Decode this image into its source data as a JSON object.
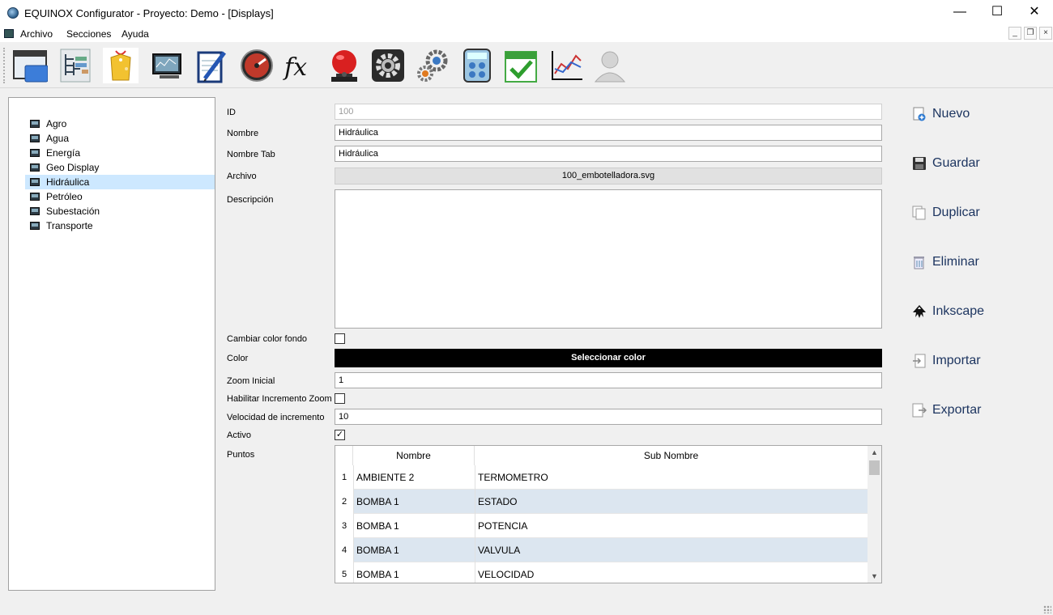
{
  "window": {
    "title": "EQUINOX Configurator - Proyecto: Demo - [Displays]"
  },
  "menu": {
    "items": [
      "Archivo",
      "Secciones",
      "Ayuda"
    ]
  },
  "toolbar": {
    "icons": [
      "window-icon",
      "tree-structure-icon",
      "tags-icon",
      "monitor-icon",
      "notepad-pen-icon",
      "gauge-icon",
      "function-fx-icon",
      "alarm-bell-icon",
      "gear-icon",
      "gears-icon",
      "calculator-icon",
      "calendar-check-icon",
      "line-chart-icon",
      "user-icon"
    ]
  },
  "tree": {
    "items": [
      {
        "label": "Agro"
      },
      {
        "label": "Agua"
      },
      {
        "label": "Energía"
      },
      {
        "label": "Geo Display"
      },
      {
        "label": "Hidráulica"
      },
      {
        "label": "Petróleo"
      },
      {
        "label": "Subestación"
      },
      {
        "label": "Transporte"
      }
    ],
    "selected": "Hidráulica"
  },
  "form": {
    "id_label": "ID",
    "id_value": "100",
    "nombre_label": "Nombre",
    "nombre_value": "Hidráulica",
    "nombre_tab_label": "Nombre Tab",
    "nombre_tab_value": "Hidráulica",
    "archivo_label": "Archivo",
    "archivo_value": "100_embotelladora.svg",
    "descripcion_label": "Descripción",
    "descripcion_value": "",
    "cambiar_color_label": "Cambiar color fondo",
    "cambiar_color_checked": false,
    "color_label": "Color",
    "color_button": "Seleccionar color",
    "color_value": "#000000",
    "zoom_label": "Zoom Inicial",
    "zoom_value": "1",
    "habilitar_zoom_label": "Habilitar Incremento Zoom",
    "habilitar_zoom_checked": false,
    "velocidad_label": "Velocidad de incremento",
    "velocidad_value": "10",
    "activo_label": "Activo",
    "activo_checked": true,
    "activo_mark": "✓",
    "puntos_label": "Puntos"
  },
  "points_table": {
    "columns": [
      "Nombre",
      "Sub Nombre"
    ],
    "rows": [
      {
        "num": "1",
        "nombre": "AMBIENTE 2",
        "sub_nombre": "TERMOMETRO"
      },
      {
        "num": "2",
        "nombre": "BOMBA 1",
        "sub_nombre": "ESTADO"
      },
      {
        "num": "3",
        "nombre": "BOMBA 1",
        "sub_nombre": "POTENCIA"
      },
      {
        "num": "4",
        "nombre": "BOMBA 1",
        "sub_nombre": "VALVULA"
      },
      {
        "num": "5",
        "nombre": "BOMBA 1",
        "sub_nombre": "VELOCIDAD"
      }
    ]
  },
  "actions": [
    {
      "label": "Nuevo",
      "icon": "new-icon"
    },
    {
      "label": "Guardar",
      "icon": "save-icon"
    },
    {
      "label": "Duplicar",
      "icon": "duplicate-icon"
    },
    {
      "label": "Eliminar",
      "icon": "delete-icon"
    },
    {
      "label": "Inkscape",
      "icon": "inkscape-icon"
    },
    {
      "label": "Importar",
      "icon": "import-icon"
    },
    {
      "label": "Exportar",
      "icon": "export-icon"
    }
  ],
  "colors": {
    "selection": "#cde8ff",
    "row_alt": "#dce6f0",
    "action_text": "#1d3560"
  }
}
